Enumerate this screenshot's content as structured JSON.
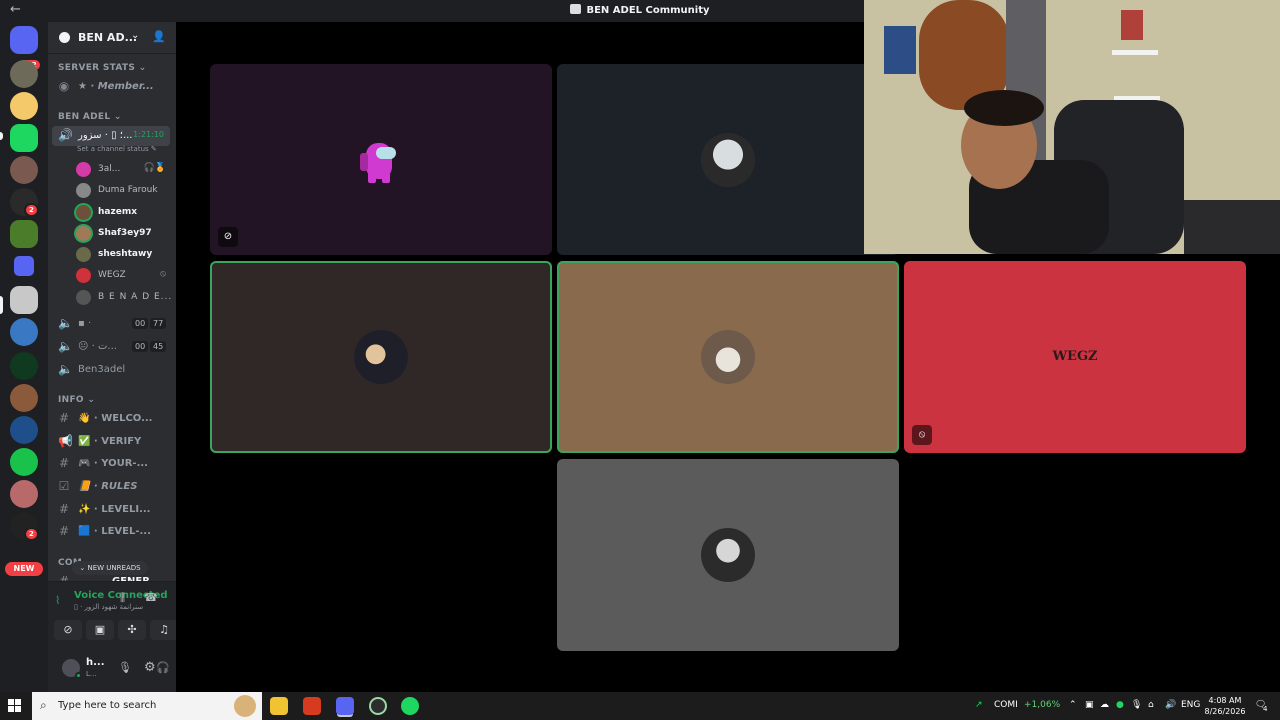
{
  "window": {
    "title": "BEN ADEL Community"
  },
  "rail": {
    "home_badge": "342",
    "badge_tnt": "2",
    "badge_c": "2",
    "new_label": "NEW"
  },
  "guild": {
    "name": "BEN AD..."
  },
  "categories": {
    "stats": "SERVER STATS",
    "voice": "BEN ADEL",
    "info": "INFO",
    "community": "COM"
  },
  "channels": {
    "members": "★ · Member...",
    "active_voice": "؛ ▯ · سزور...",
    "active_time": "1:21:10",
    "channel_status": "Set a channel status",
    "voice2": "▪ ·",
    "voice2_a": "00",
    "voice2_b": "77",
    "voice3": "😐 · ت...",
    "voice3_a": "00",
    "voice3_b": "45",
    "ben3adel": "Ben3adel",
    "welcome": "👋 · WELCO...",
    "verify": "✅ · VERIFY",
    "your": "🎮 · YOUR-...",
    "rules": "📙 · RULES",
    "leveling": "✨ · LEVELI...",
    "level2": "🟦 · LEVEL-...",
    "general": "GENER"
  },
  "voice_users": [
    {
      "name": "3al..."
    },
    {
      "name": "Duma Farouk"
    },
    {
      "name": "hazemx"
    },
    {
      "name": "Shaf3ey97"
    },
    {
      "name": "sheshtawy"
    },
    {
      "name": "WEGZ"
    },
    {
      "name": "B E N A D E..."
    }
  ],
  "new_unreads": "NEW UNREADS",
  "voice_panel": {
    "title": "Voice Connected",
    "subtitle": "▯ · سنرانمة شهود الزور"
  },
  "user_panel": {
    "name": "h...",
    "sub": "L..."
  },
  "tiles": {
    "wegz_logo": "WEGZ"
  },
  "taskbar": {
    "search_placeholder": "Type here to search",
    "stock_name": "COMI",
    "stock_change": "+1,06%",
    "lang": "ENG",
    "time": "4:08 AM",
    "date": "8/26/2026",
    "notif_count": "4"
  }
}
